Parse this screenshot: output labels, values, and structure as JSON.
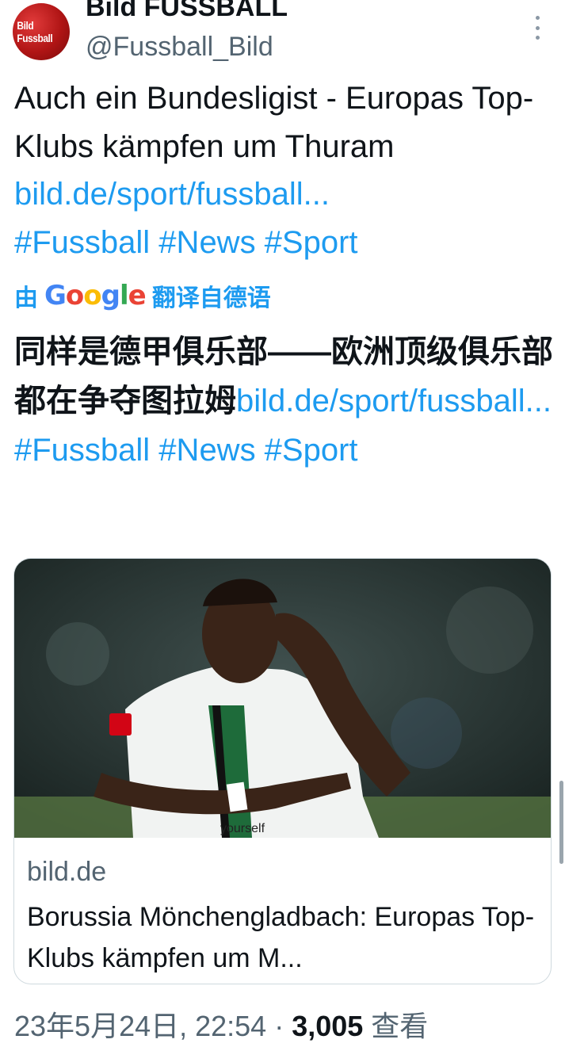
{
  "account": {
    "display_name": "Bild FUSSBALL",
    "handle": "@Fussball_Bild",
    "avatar_logo_text": "Bild Fussball"
  },
  "tweet": {
    "text": "Auch ein Bundesligist - Europas Top-Klubs kämpfen um Thuram ",
    "link": "bild.de/sport/fussball...",
    "hashtags": "#Fussball #News #Sport"
  },
  "translation": {
    "prefix": "由",
    "google": [
      "G",
      "o",
      "o",
      "g",
      "l",
      "e"
    ],
    "suffix": "翻译自德语",
    "text": "同样是德甲俱乐部——欧洲顶级俱乐部都在争夺图拉姆",
    "link": "bild.de/sport/fussball...",
    "hashtags": " #Fussball #News #Sport"
  },
  "card": {
    "image_alt": "Borussia Mönchengladbach player in white jersey",
    "jersey_text": "yourself",
    "domain": "bild.de",
    "title": "Borussia Mönchengladbach: Europas Top-Klubs kämpfen um M..."
  },
  "meta": {
    "datetime": "23年5月24日, 22:54",
    "separator": " · ",
    "views_count": "3,005",
    "views_label": " 查看"
  },
  "colors": {
    "link": "#1d9bf0",
    "secondary_text": "#536471",
    "primary_text": "#0f1419",
    "border": "#cfd9de"
  },
  "icons": [
    "more-vertical-icon",
    "google-logo"
  ]
}
